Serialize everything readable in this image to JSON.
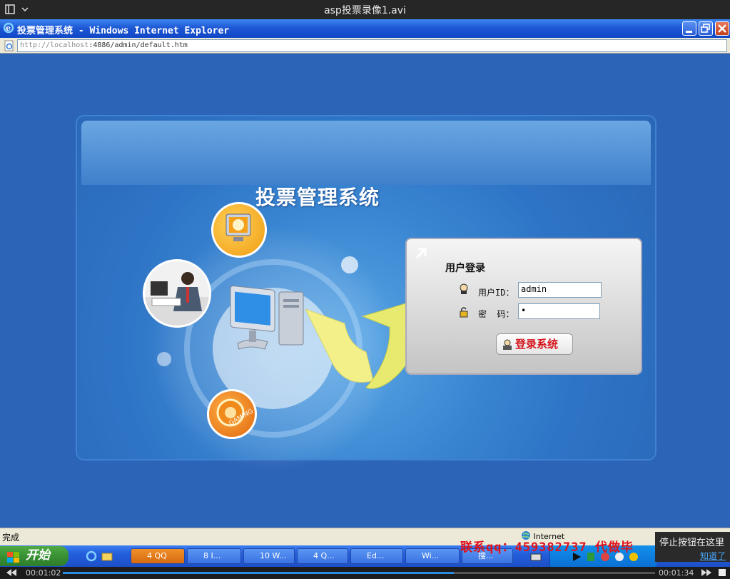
{
  "player": {
    "title": "asp投票录像1.avi",
    "time_current": "00:01:02",
    "time_total": "00:01:34",
    "progress": 0.66
  },
  "ie": {
    "window_title": "投票管理系统 - Windows Internet Explorer",
    "address_host": "http://localhost",
    "address_rest": ":4886/admin/default.htm",
    "status_text": "完成",
    "status_zone": "Internet"
  },
  "login_page": {
    "system_title": "投票管理系统",
    "heading": "用户登录",
    "user_label": "用户ID：",
    "user_value": "admin",
    "password_label": "密  码：",
    "password_value": "•",
    "submit_label": "登录系统"
  },
  "taskbar": {
    "start_label": "开始",
    "items": [
      {
        "label": "4 QQ"
      },
      {
        "label": "8 I..."
      },
      {
        "label": "10 W..."
      },
      {
        "label": "4 Q..."
      },
      {
        "label": "Ed..."
      },
      {
        "label": "Wi..."
      },
      {
        "label": "搜..."
      }
    ]
  },
  "overlay": {
    "watermark": "联系qq：459382737 代做毕",
    "tooltip_text": "停止按钮在这里",
    "tooltip_link": "知道了"
  },
  "colors": {
    "page_bg": "#2c64b8",
    "submit_text": "#d4141b",
    "watermark": "#e0121a",
    "xp_title": "#1e58d5"
  }
}
